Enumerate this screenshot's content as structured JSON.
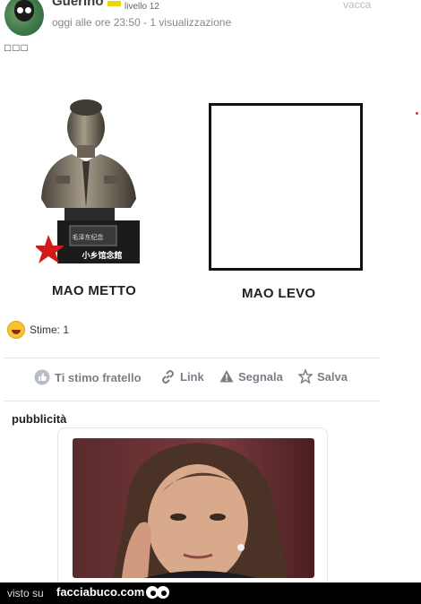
{
  "post": {
    "username": "Guerino",
    "level": "livello 12",
    "meta": "oggi alle ore 23:50 - 1 visualizzazione",
    "corner_text": "vacca",
    "glyphs": "□□□"
  },
  "meme": {
    "left_caption": "MAO METTO",
    "right_caption": "MAO LEVO",
    "stamp_text": "毛泽东纪念",
    "watermark": "小乡馆念館"
  },
  "stime": {
    "label": "Stime: 1"
  },
  "actions": [
    {
      "label": "Ti stimo fratello",
      "icon": "thumb-icon"
    },
    {
      "label": "Link",
      "icon": "link-icon"
    },
    {
      "label": "Segnala",
      "icon": "warning-icon"
    },
    {
      "label": "Salva",
      "icon": "star-icon"
    }
  ],
  "ad": {
    "title": "pubblicità"
  },
  "footer": {
    "visto": "visto su",
    "brand": "facciabuco.com"
  },
  "colors": {
    "action_text": "#7a7f86",
    "level_badge": "#e8d800",
    "footer_bg": "#000000"
  }
}
